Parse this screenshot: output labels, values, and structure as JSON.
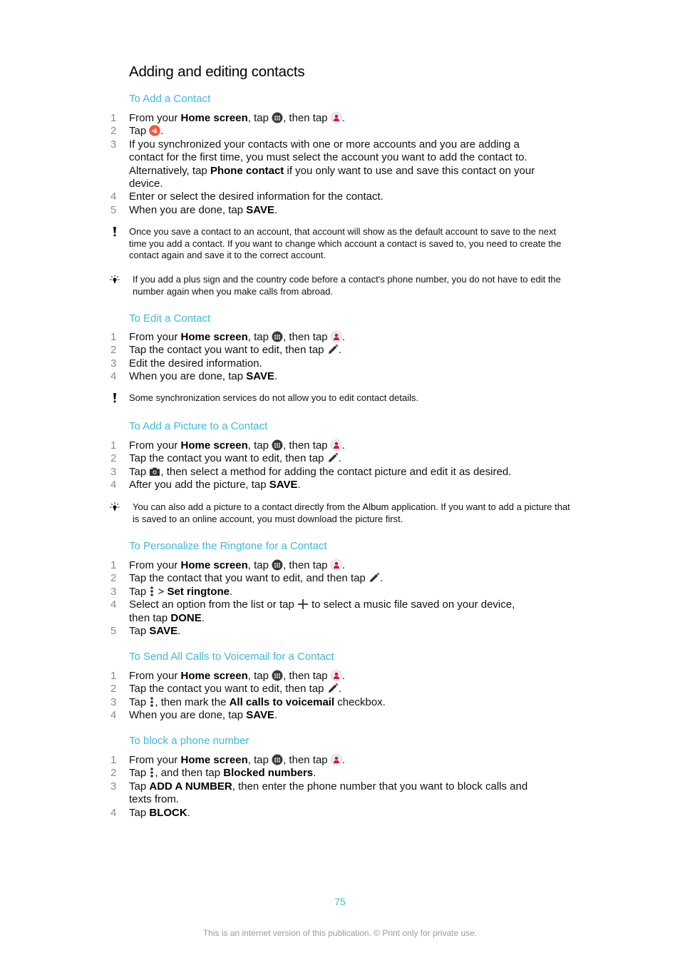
{
  "page_title": "Adding and editing contacts",
  "icons": {
    "apps": "apps-grid-icon",
    "contacts": "contacts-app-icon",
    "add_contact": "add-contact-icon",
    "edit": "pencil-edit-icon",
    "camera": "camera-icon",
    "menu": "overflow-menu-icon",
    "plus": "plus-icon",
    "warning": "exclamation-icon",
    "tip": "lightbulb-tip-icon"
  },
  "colors": {
    "accent": "#3fb8dd",
    "add_contact_icon": "#ef5a3c",
    "contacts_icon": "#c2185b"
  },
  "sections": [
    {
      "title": "To Add a Contact",
      "steps": [
        {
          "num": "1",
          "parts": [
            "From your ",
            "Home screen",
            ", tap ",
            ", then tap ",
            "."
          ]
        },
        {
          "num": "2",
          "parts": [
            "Tap ",
            "."
          ]
        },
        {
          "num": "3",
          "parts": [
            "If you synchronized your contacts with one or more accounts and you are adding a contact for the first time, you must select the account you want to add the contact to. Alternatively, tap ",
            "Phone contact",
            " if you only want to use and save this contact on your device."
          ]
        },
        {
          "num": "4",
          "parts": [
            "Enter or select the desired information for the contact."
          ]
        },
        {
          "num": "5",
          "parts": [
            "When you are done, tap ",
            "SAVE",
            "."
          ]
        }
      ],
      "notes": [
        {
          "type": "warning",
          "text": "Once you save a contact to an account, that account will show as the default account to save to the next time you add a contact. If you want to change which account a contact is saved to, you need to create the contact again and save it to the correct account."
        },
        {
          "type": "tip",
          "text": "If you add a plus sign and the country code before a contact's phone number, you do not have to edit the number again when you make calls from abroad."
        }
      ]
    },
    {
      "title": "To Edit a Contact",
      "steps": [
        {
          "num": "1",
          "parts": [
            "From your ",
            "Home screen",
            ", tap ",
            ", then tap ",
            "."
          ]
        },
        {
          "num": "2",
          "parts": [
            "Tap the contact you want to edit, then tap ",
            "."
          ]
        },
        {
          "num": "3",
          "parts": [
            "Edit the desired information."
          ]
        },
        {
          "num": "4",
          "parts": [
            "When you are done, tap ",
            "SAVE",
            "."
          ]
        }
      ],
      "notes": [
        {
          "type": "warning",
          "text": "Some synchronization services do not allow you to edit contact details."
        }
      ]
    },
    {
      "title": "To Add a Picture to a Contact",
      "steps": [
        {
          "num": "1",
          "parts": [
            "From your ",
            "Home screen",
            ", tap ",
            ", then tap ",
            "."
          ]
        },
        {
          "num": "2",
          "parts": [
            "Tap the contact you want to edit, then tap ",
            "."
          ]
        },
        {
          "num": "3",
          "parts": [
            "Tap ",
            ", then select a method for adding the contact picture and edit it as desired."
          ]
        },
        {
          "num": "4",
          "parts": [
            "After you add the picture, tap ",
            "SAVE",
            "."
          ]
        }
      ],
      "notes": [
        {
          "type": "tip",
          "parts": [
            "You can also add a picture to a contact directly from the ",
            "Album",
            " application. If you want to add a picture that is saved to an online account, you must download the picture first."
          ]
        }
      ]
    },
    {
      "title": "To Personalize the Ringtone for a Contact",
      "steps": [
        {
          "num": "1",
          "parts": [
            "From your ",
            "Home screen",
            ", tap ",
            ", then tap ",
            "."
          ]
        },
        {
          "num": "2",
          "parts": [
            "Tap the contact that you want to edit, and then tap ",
            "."
          ]
        },
        {
          "num": "3",
          "parts": [
            "Tap ",
            " > ",
            "Set ringtone",
            "."
          ]
        },
        {
          "num": "4",
          "parts": [
            "Select an option from the list or tap ",
            " to select a music file saved on your device, then tap ",
            "DONE",
            "."
          ]
        },
        {
          "num": "5",
          "parts": [
            "Tap ",
            "SAVE",
            "."
          ]
        }
      ]
    },
    {
      "title": "To Send All Calls to Voicemail for a Contact",
      "steps": [
        {
          "num": "1",
          "parts": [
            "From your ",
            "Home screen",
            ", tap ",
            ", then tap ",
            "."
          ]
        },
        {
          "num": "2",
          "parts": [
            "Tap the contact you want to edit, then tap ",
            "."
          ]
        },
        {
          "num": "3",
          "parts": [
            "Tap ",
            ", then mark the ",
            "All calls to voicemail",
            " checkbox."
          ]
        },
        {
          "num": "4",
          "parts": [
            "When you are done, tap ",
            "SAVE",
            "."
          ]
        }
      ]
    },
    {
      "title": "To block a phone number",
      "steps": [
        {
          "num": "1",
          "parts": [
            "From your ",
            "Home screen",
            ", tap ",
            ", then tap ",
            "."
          ]
        },
        {
          "num": "2",
          "parts": [
            "Tap ",
            ", and then tap ",
            "Blocked numbers",
            "."
          ]
        },
        {
          "num": "3",
          "parts": [
            "Tap ",
            "ADD A NUMBER",
            ", then enter the phone number that you want to block calls and texts from."
          ]
        },
        {
          "num": "4",
          "parts": [
            "Tap ",
            "BLOCK",
            "."
          ]
        }
      ]
    }
  ],
  "footer": {
    "page_number": "75",
    "notice": "This is an internet version of this publication. © Print only for private use."
  }
}
